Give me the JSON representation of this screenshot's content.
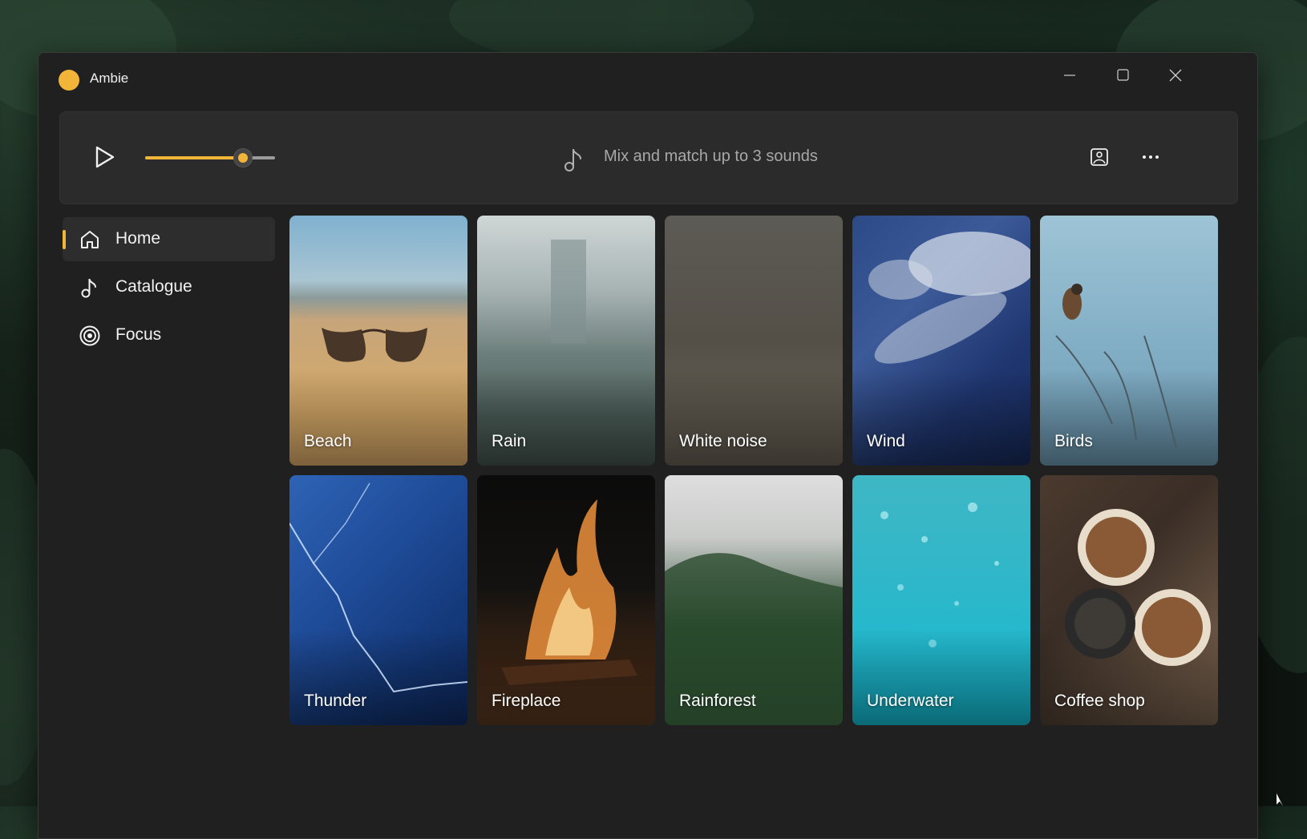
{
  "window": {
    "title": "Ambie"
  },
  "toolbar": {
    "volume_percent": 75,
    "hint": "Mix and match up to 3 sounds"
  },
  "nav": {
    "items": [
      {
        "label": "Home",
        "icon": "home-icon",
        "selected": true
      },
      {
        "label": "Catalogue",
        "icon": "music-note-icon",
        "selected": false
      },
      {
        "label": "Focus",
        "icon": "target-icon",
        "selected": false
      }
    ]
  },
  "sounds": [
    {
      "label": "Beach"
    },
    {
      "label": "Rain"
    },
    {
      "label": "White noise"
    },
    {
      "label": "Wind"
    },
    {
      "label": "Birds"
    },
    {
      "label": "Thunder"
    },
    {
      "label": "Fireplace"
    },
    {
      "label": "Rainforest"
    },
    {
      "label": "Underwater"
    },
    {
      "label": "Coffee shop"
    }
  ],
  "colors": {
    "accent": "#f2b53a",
    "window_bg": "#202020",
    "panel_bg": "#2b2b2b"
  }
}
